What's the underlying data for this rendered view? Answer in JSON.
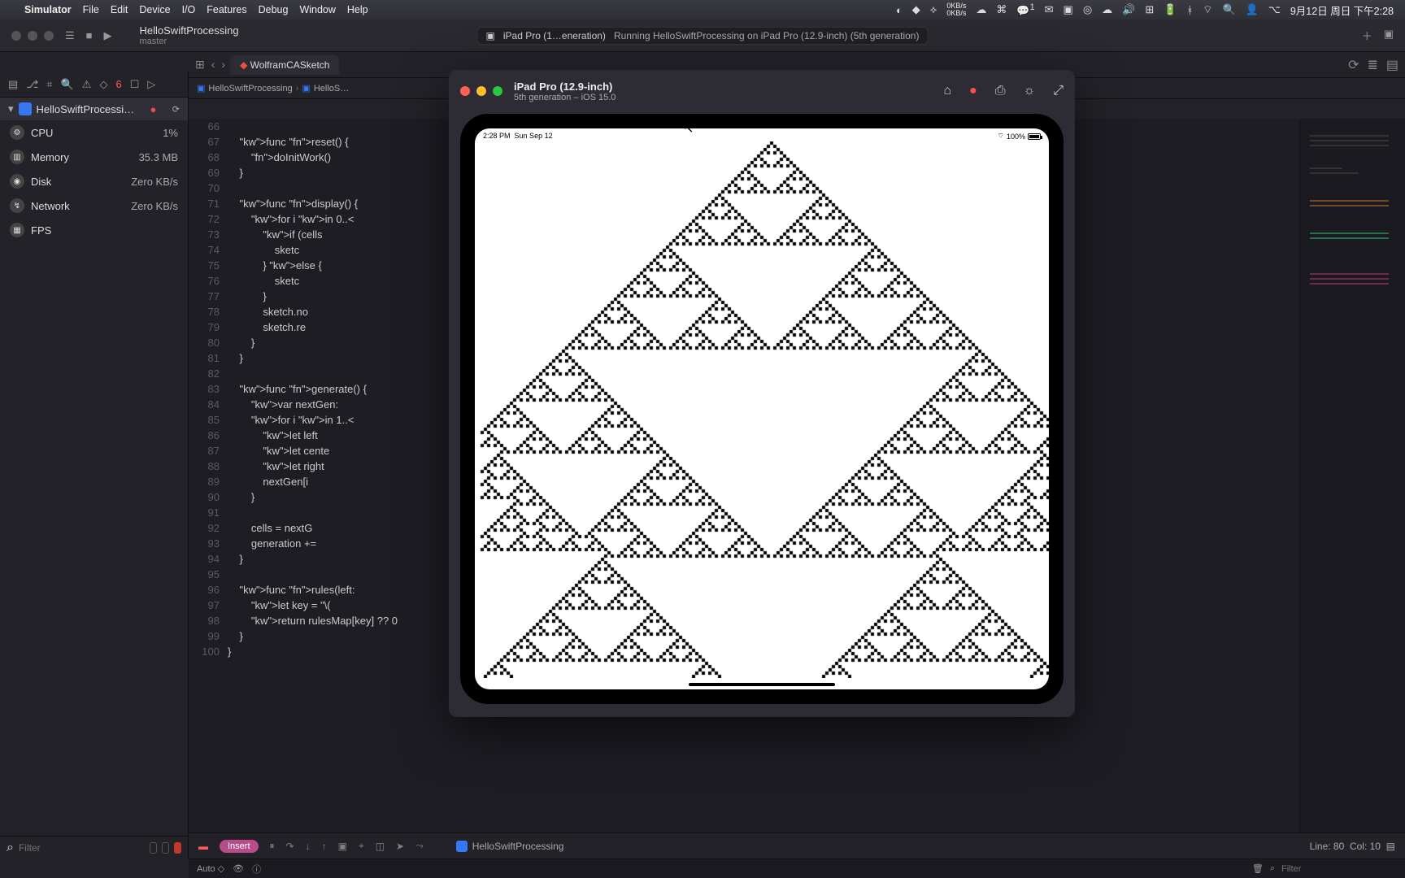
{
  "menubar": {
    "app": "Simulator",
    "items": [
      "File",
      "Edit",
      "Device",
      "I/O",
      "Features",
      "Debug",
      "Window",
      "Help"
    ],
    "net_up": "0KB/s",
    "net_down": "0KB/s",
    "cc_badge": "1",
    "clock": "9月12日 周日 下午2:28"
  },
  "xcode": {
    "project": "HelloSwiftProcessing",
    "branch": "master",
    "stop_icon": "■",
    "run_icon": "▶",
    "destination": "iPad Pro (1…eneration)",
    "status": "Running HelloSwiftProcessing on iPad Pro (12.9-inch) (5th generation)",
    "tab": "WolframCASketch",
    "crumb1": "HelloSwiftProcessing",
    "crumb2": "HelloS…"
  },
  "nav": {
    "err_count": "6",
    "project_name": "HelloSwiftProcessi…",
    "metrics": [
      {
        "name": "CPU",
        "value": "1%"
      },
      {
        "name": "Memory",
        "value": "35.3 MB"
      },
      {
        "name": "Disk",
        "value": "Zero KB/s"
      },
      {
        "name": "Network",
        "value": "Zero KB/s"
      },
      {
        "name": "FPS",
        "value": ""
      }
    ],
    "filter_placeholder": "Filter"
  },
  "code": {
    "start": 66,
    "lines": [
      "",
      "    func reset() {",
      "        doInitWork()",
      "    }",
      "",
      "    func display() {",
      "        for i in 0..<",
      "            if (cells",
      "                sketc",
      "            } else {",
      "                sketc",
      "            }",
      "            sketch.no",
      "            sketch.re",
      "        }",
      "    }",
      "",
      "    func generate() {",
      "        var nextGen:",
      "        for i in 1..<",
      "            let left",
      "            let cente",
      "            let right",
      "            nextGen[i",
      "        }",
      "",
      "        cells = nextG",
      "        generation +=",
      "    }",
      "",
      "    func rules(left:",
      "        let key = \"\\(",
      "        return rulesMap[key] ?? 0",
      "    }",
      "}"
    ]
  },
  "debug": {
    "insert": "Insert",
    "process": "HelloSwiftProcessing",
    "line": "Line: 80",
    "col": "Col: 10"
  },
  "status": {
    "auto": "Auto ◇",
    "filter_placeholder": "Filter"
  },
  "sim": {
    "title": "iPad Pro (12.9-inch)",
    "subtitle": "5th generation – iOS 15.0",
    "status_time": "2:28 PM",
    "status_date": "Sun Sep 12",
    "battery": "100%"
  },
  "chart_data": {
    "type": "cellular-automaton",
    "description": "Sierpinski-triangle pattern (Wolfram Rule 90) rendered on the iPad screen",
    "rule": 90,
    "generations_approx": 180,
    "cell_states": [
      0,
      1
    ],
    "colors": {
      "0": "#ffffff",
      "1": "#000000"
    }
  }
}
